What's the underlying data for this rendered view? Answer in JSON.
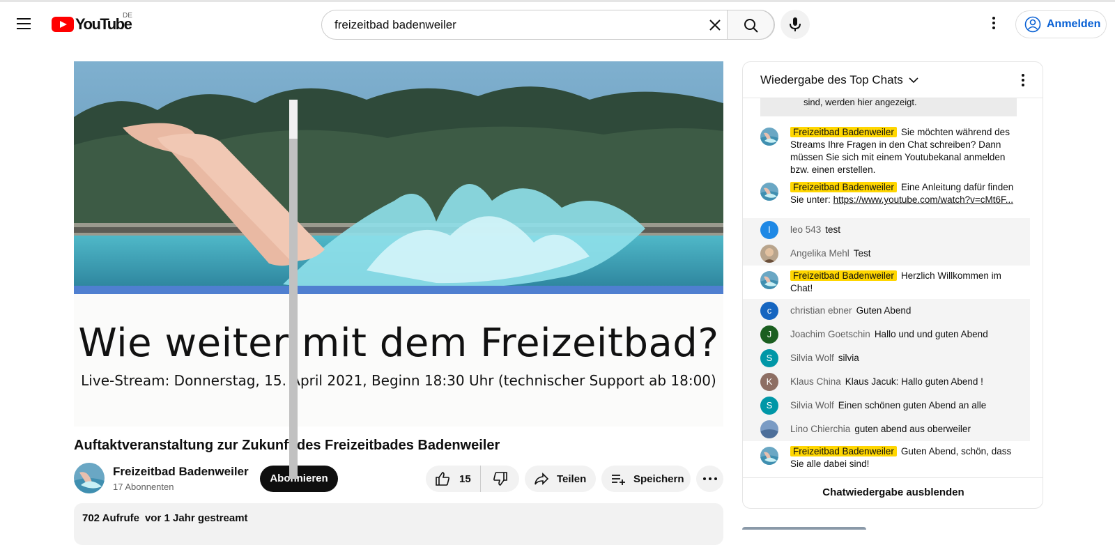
{
  "header": {
    "country_code": "DE",
    "logo_text": "YouTube",
    "search_value": "freizeitbad badenweiler",
    "sign_in_label": "Anmelden"
  },
  "slide": {
    "title": "Wie weiter mit dem Freizeitbad?",
    "subtitle": "Live-Stream: Donnerstag, 15. April 2021, Beginn 18:30 Uhr (technischer Support ab 18:00)"
  },
  "video": {
    "title": "Auftaktveranstaltung zur Zukunft des Freizeitbades Badenweiler",
    "channel_name": "Freizeitbad Badenweiler",
    "subscriber_count": "17 Abonnenten",
    "subscribe_label": "Abonnieren",
    "like_count": "15",
    "share_label": "Teilen",
    "save_label": "Speichern",
    "views": "702 Aufrufe",
    "streamed": "vor 1 Jahr gestreamt"
  },
  "chat": {
    "header_title": "Wiedergabe des Top Chats",
    "notice_text": "sind, werden hier angezeigt.",
    "hide_label": "Chatwiedergabe ausblenden",
    "messages": [
      {
        "author": "Freizeitbad Badenweiler",
        "text": "Sie möchten während des Streams Ihre Fragen in den Chat schreiben? Dann müssen Sie sich mit einem Youtubekanal anmelden bzw. einen erstellen.",
        "owner": true
      },
      {
        "author": "Freizeitbad Badenweiler",
        "text": "Eine Anleitung dafür finden Sie unter:",
        "link": "https://www.youtube.com/watch?v=cMt6F...",
        "owner": true
      },
      {
        "author": "leo 543",
        "text": "test",
        "initial": "l",
        "color": "#1e88e5"
      },
      {
        "author": "Angelika Mehl",
        "text": "Test"
      },
      {
        "author": "Freizeitbad Badenweiler",
        "text": "Herzlich Willkommen im Chat!",
        "owner": true
      },
      {
        "author": "christian ebner",
        "text": "Guten Abend",
        "initial": "c",
        "color": "#1565c0"
      },
      {
        "author": "Joachim Goetschin",
        "text": "Hallo und und guten Abend",
        "initial": "J",
        "color": "#1b5e20"
      },
      {
        "author": "Silvia Wolf",
        "text": "silvia",
        "initial": "S",
        "color": "#0097a7"
      },
      {
        "author": "Klaus China",
        "text": "Klaus Jacuk: Hallo guten Abend !",
        "initial": "K",
        "color": "#8d6e63"
      },
      {
        "author": "Silvia Wolf",
        "text": "Einen schönen guten Abend an alle",
        "initial": "S",
        "color": "#0097a7"
      },
      {
        "author": "Lino Chierchia",
        "text": "guten abend aus oberweiler"
      },
      {
        "author": "Freizeitbad Badenweiler",
        "text": "Guten Abend, schön, dass Sie alle dabei sind!",
        "owner": true
      }
    ]
  }
}
